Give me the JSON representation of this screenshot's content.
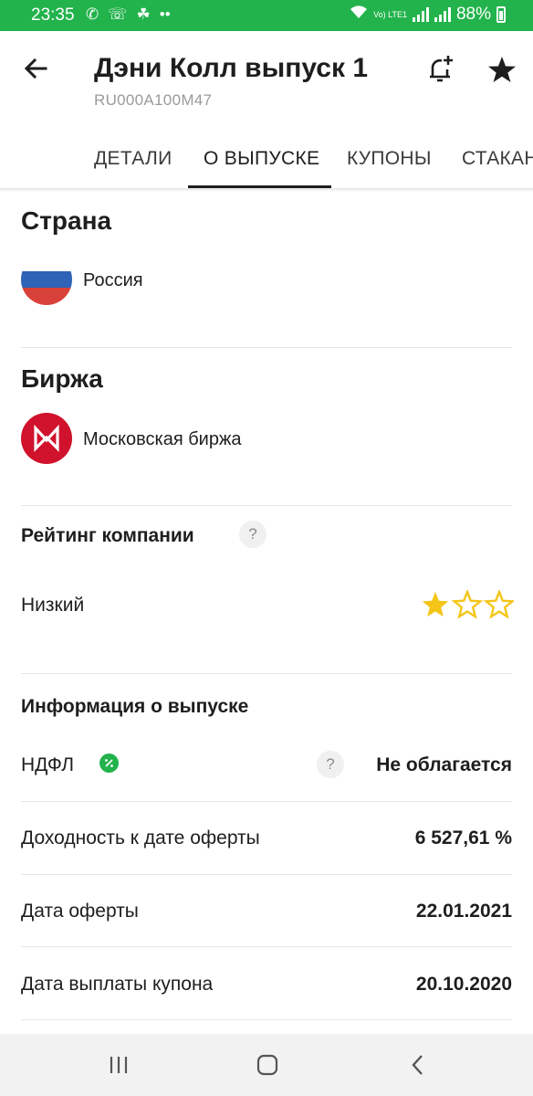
{
  "status_bar": {
    "time": "23:35",
    "battery": "88%",
    "lte_label": "Vo) LTE1"
  },
  "header": {
    "title": "Дэни Колл выпуск 1",
    "isin": "RU000A100M47",
    "back_icon": "arrow-left-icon",
    "notify_icon": "bell-plus-icon",
    "favorite_icon": "star-icon"
  },
  "tabs": [
    {
      "label": "ДЕТАЛИ",
      "active": false
    },
    {
      "label": "О ВЫПУСКЕ",
      "active": true
    },
    {
      "label": "КУПОНЫ",
      "active": false
    },
    {
      "label": "СТАКАН",
      "active": false
    }
  ],
  "country": {
    "title": "Страна",
    "value": "Россия",
    "flag_colors": [
      "#ffffff",
      "#2f63b8",
      "#d8423a"
    ]
  },
  "exchange": {
    "title": "Биржа",
    "value": "Московская биржа",
    "logo_color": "#d0122c"
  },
  "rating": {
    "title": "Рейтинг компании",
    "help": "?",
    "level": "Низкий",
    "stars_filled": 1,
    "stars_total": 3,
    "star_color": "#f5c518"
  },
  "issue_info": {
    "title": "Информация о выпуске",
    "rows": [
      {
        "label": "НДФЛ",
        "value": "Не облагается",
        "help": "?"
      },
      {
        "label": "Доходность к дате оферты",
        "value": "6 527,61 %"
      },
      {
        "label": "Дата оферты",
        "value": "22.01.2021"
      },
      {
        "label": "Дата выплаты купона",
        "value": "20.10.2020"
      }
    ]
  },
  "navbar": {
    "recents_icon": "recents-icon",
    "home_icon": "home-icon",
    "back_icon": "back-chevron-icon"
  },
  "colors": {
    "accent_green": "#22b34c",
    "text": "#1e1e1e",
    "muted": "#9a9a9a"
  }
}
